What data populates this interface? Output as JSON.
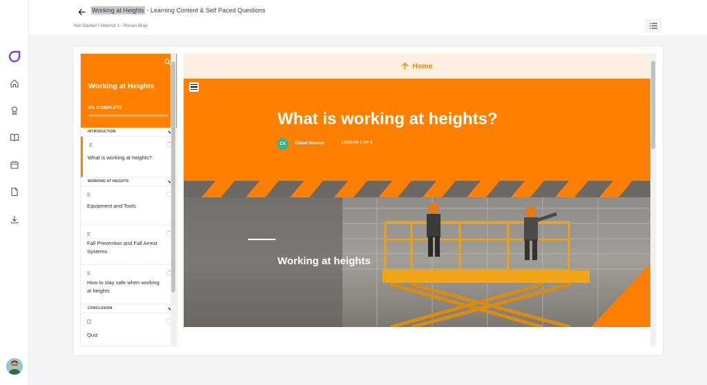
{
  "rail": {
    "items": [
      "home-icon",
      "award-icon",
      "book-icon",
      "calendar-icon",
      "file-icon",
      "download-icon"
    ]
  },
  "header": {
    "title_highlight": "Working at Heights",
    "title_rest": " - Learning Content & Self Paced Questions",
    "subtitle": "Not Started • Attempt 1 - Ronan Bray"
  },
  "sidebar": {
    "title": "Working at Heights",
    "progress_label": "0% COMPLETE",
    "progress": 0,
    "sections": [
      {
        "label": "INTRODUCTION",
        "lessons": [
          {
            "name": "What is working at heights?",
            "active": true
          }
        ]
      },
      {
        "label": "WORKING AT HEIGHTS",
        "lessons": [
          {
            "name": "Equipment and Tools"
          },
          {
            "name": "Fall Prevention and Fall Arrest Systems"
          },
          {
            "name": "How to stay safe when working at heights"
          }
        ]
      },
      {
        "label": "CONCLUSION",
        "lessons": [
          {
            "name": "Quiz"
          }
        ]
      }
    ]
  },
  "content": {
    "home_label": "Home",
    "hero_title": "What is working at heights?",
    "author_initials": "CA",
    "author_name": "Cloud Assess",
    "lesson_count": "LESSON 1 OF 6",
    "photo_caption": "Working at heights"
  },
  "colors": {
    "accent": "#ff7f00",
    "home_bar": "#fdf0e3"
  }
}
